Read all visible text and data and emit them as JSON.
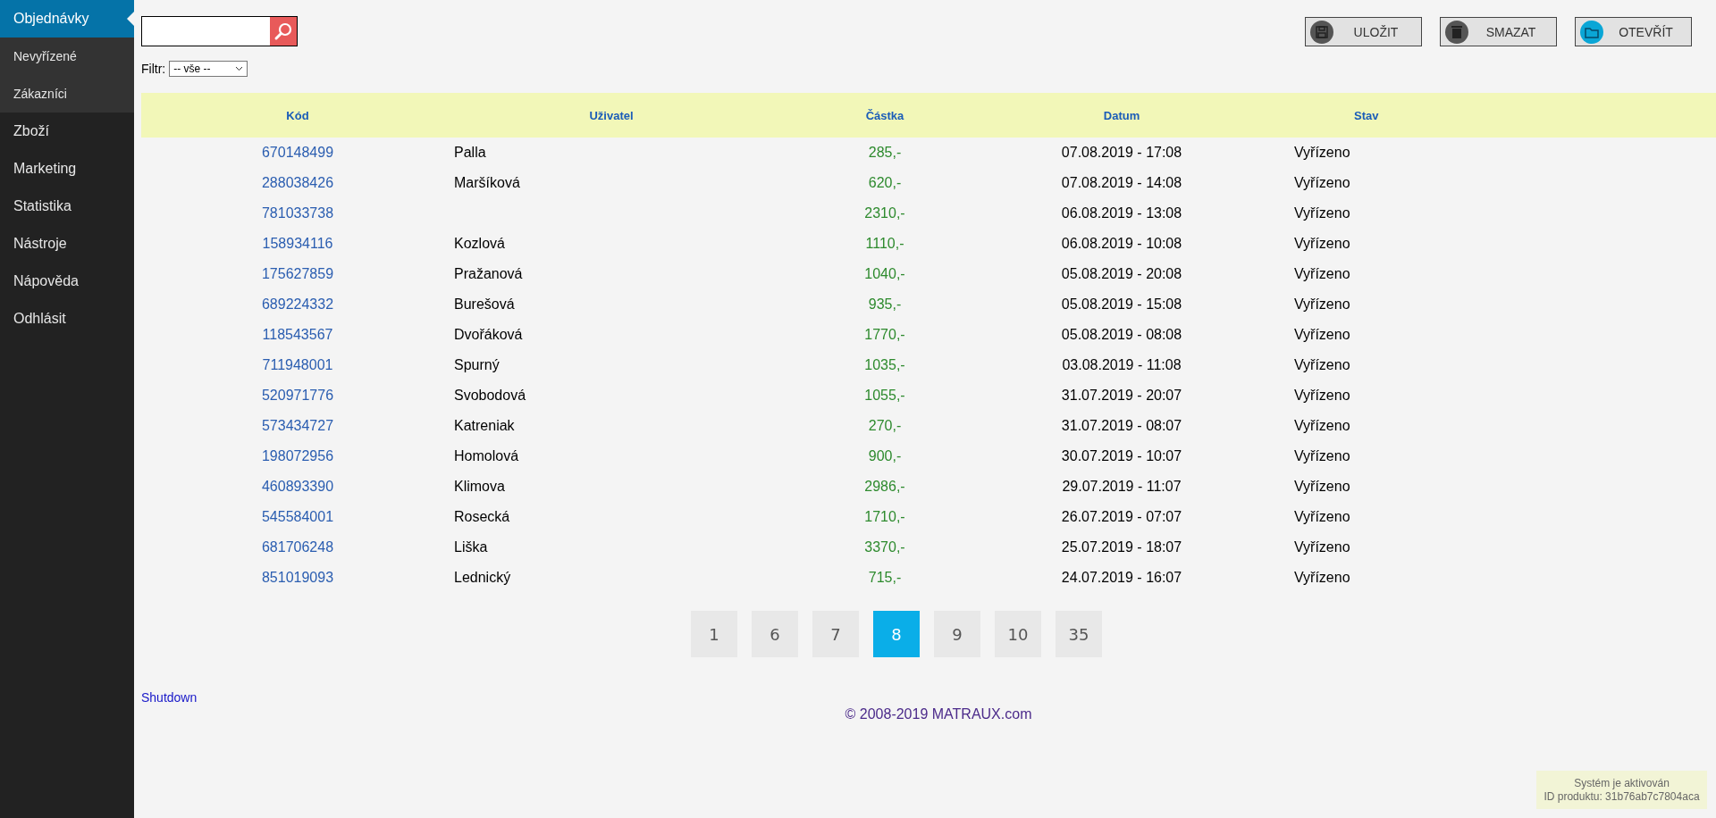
{
  "sidebar": {
    "items": [
      {
        "label": "Objednávky",
        "selected": true,
        "kind": "main"
      },
      {
        "label": "Nevyřízené",
        "selected": false,
        "kind": "sub"
      },
      {
        "label": "Zákazníci",
        "selected": false,
        "kind": "sub"
      },
      {
        "label": "Zboží",
        "selected": false,
        "kind": "main"
      },
      {
        "label": "Marketing",
        "selected": false,
        "kind": "main"
      },
      {
        "label": "Statistika",
        "selected": false,
        "kind": "main"
      },
      {
        "label": "Nástroje",
        "selected": false,
        "kind": "main"
      },
      {
        "label": "Nápověda",
        "selected": false,
        "kind": "main"
      },
      {
        "label": "Odhlásit",
        "selected": false,
        "kind": "main"
      }
    ]
  },
  "filter": {
    "label": "Filtr:",
    "value": "-- vše --"
  },
  "toolbar": [
    {
      "label": "ULOŽIT",
      "kind": "save"
    },
    {
      "label": "SMAZAT",
      "kind": "delete"
    },
    {
      "label": "OTEVŘÍT",
      "kind": "open"
    }
  ],
  "table": {
    "columns": [
      "Kód",
      "Uživatel",
      "Částka",
      "Datum",
      "Stav"
    ],
    "rows": [
      [
        "670148499",
        "Palla",
        "285,-",
        "07.08.2019 - 17:08",
        "Vyřízeno"
      ],
      [
        "288038426",
        "Maršíková",
        "620,-",
        "07.08.2019 - 14:08",
        "Vyřízeno"
      ],
      [
        "781033738",
        "",
        "2310,-",
        "06.08.2019 - 13:08",
        "Vyřízeno"
      ],
      [
        "158934116",
        "Kozlová",
        "1110,-",
        "06.08.2019 - 10:08",
        "Vyřízeno"
      ],
      [
        "175627859",
        "Pražanová",
        "1040,-",
        "05.08.2019 - 20:08",
        "Vyřízeno"
      ],
      [
        "689224332",
        "Burešová",
        "935,-",
        "05.08.2019 - 15:08",
        "Vyřízeno"
      ],
      [
        "118543567",
        "Dvořáková",
        "1770,-",
        "05.08.2019 - 08:08",
        "Vyřízeno"
      ],
      [
        "711948001",
        "Spurný",
        "1035,-",
        "03.08.2019 - 11:08",
        "Vyřízeno"
      ],
      [
        "520971776",
        "Svobodová",
        "1055,-",
        "31.07.2019 - 20:07",
        "Vyřízeno"
      ],
      [
        "573434727",
        "Katreniak",
        "270,-",
        "31.07.2019 - 08:07",
        "Vyřízeno"
      ],
      [
        "198072956",
        "Homolová",
        "900,-",
        "30.07.2019 - 10:07",
        "Vyřízeno"
      ],
      [
        "460893390",
        "Klimova",
        "2986,-",
        "29.07.2019 - 11:07",
        "Vyřízeno"
      ],
      [
        "545584001",
        "Rosecká",
        "1710,-",
        "26.07.2019 - 07:07",
        "Vyřízeno"
      ],
      [
        "681706248",
        "Liška",
        "3370,-",
        "25.07.2019 - 18:07",
        "Vyřízeno"
      ],
      [
        "851019093",
        "Lednický",
        "715,-",
        "24.07.2019 - 16:07",
        "Vyřízeno"
      ]
    ]
  },
  "pagination": [
    {
      "label": "1",
      "selected": false
    },
    {
      "label": "6",
      "selected": false
    },
    {
      "label": "7",
      "selected": false
    },
    {
      "label": "8",
      "selected": true
    },
    {
      "label": "9",
      "selected": false
    },
    {
      "label": "10",
      "selected": false
    },
    {
      "label": "35",
      "selected": false
    }
  ],
  "shutdown_link": "Shutdown",
  "footer": "© 2008-2019 MATRAUX.com",
  "status": {
    "line_1": "Systém je aktivován",
    "line_2": "ID produktu: 31b76ab7c7804aca"
  }
}
